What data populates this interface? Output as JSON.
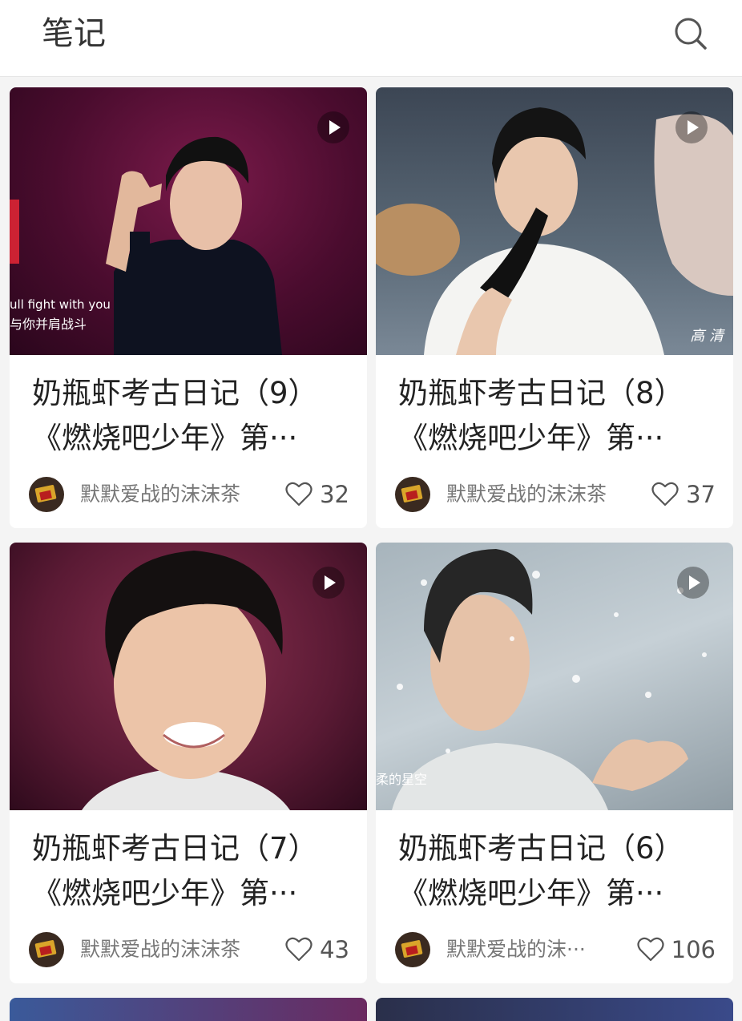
{
  "header": {
    "title": "笔记",
    "search_icon": "search-icon"
  },
  "cards": [
    {
      "title_line1": "奶瓶虾考古日记（9）",
      "title_line2": "《燃烧吧少年》第···",
      "author": "默默爱战的沫沫茶",
      "likes": "32",
      "overlay_en": "ull fight with you",
      "overlay_cn": "与你并肩战斗"
    },
    {
      "title_line1": "奶瓶虾考古日记（8）",
      "title_line2": "《燃烧吧少年》第···",
      "author": "默默爱战的沫沫茶",
      "likes": "37",
      "overlay_badge": "高 清"
    },
    {
      "title_line1": "奶瓶虾考古日记（7）",
      "title_line2": "《燃烧吧少年》第···",
      "author": "默默爱战的沫沫茶",
      "likes": "43"
    },
    {
      "title_line1": "奶瓶虾考古日记（6）",
      "title_line2": "《燃烧吧少年》第···",
      "author": "默默爱战的沫···",
      "likes": "106",
      "overlay_text": "柔的星空"
    }
  ],
  "colors": {
    "background": "#f4f4f4",
    "card": "#ffffff",
    "title_text": "#222222",
    "meta_text": "#777777"
  }
}
